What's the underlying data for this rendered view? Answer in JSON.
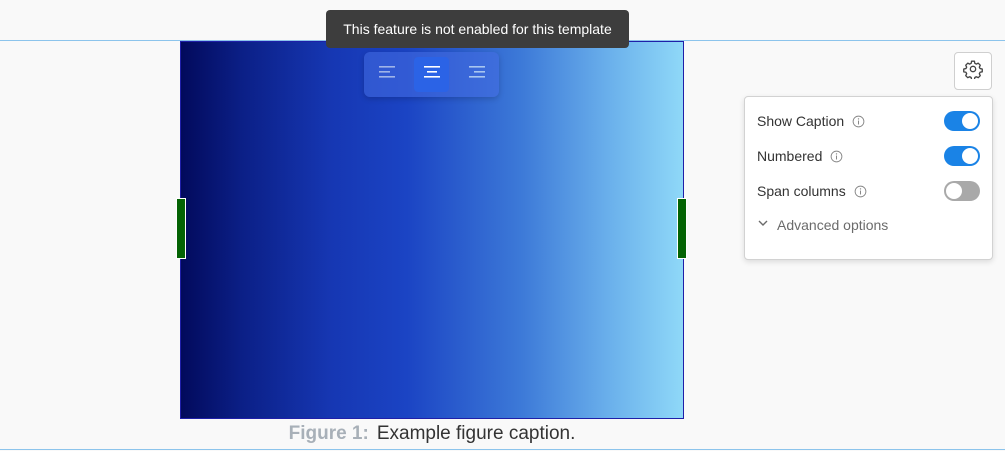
{
  "tooltip": {
    "text": "This feature is not enabled for this template"
  },
  "toolbar": {
    "buttons": [
      {
        "icon": "align-left-icon"
      },
      {
        "icon": "align-center-icon",
        "active": true
      },
      {
        "icon": "align-right-icon"
      }
    ]
  },
  "settings": {
    "icon": "gear-icon",
    "options": [
      {
        "label": "Show Caption",
        "enabled": true
      },
      {
        "label": "Numbered",
        "enabled": true
      },
      {
        "label": "Span columns",
        "enabled": false
      }
    ],
    "advanced_label": "Advanced options"
  },
  "caption": {
    "prefix": "Figure 1:",
    "text": "Example figure caption."
  },
  "colors": {
    "accent": "#1a83e6",
    "active_align": "#2b63e6",
    "handle": "#046304",
    "rule": "#8cc4ec",
    "gradient_start": "#020a5c",
    "gradient_end": "#8fd8f8"
  }
}
